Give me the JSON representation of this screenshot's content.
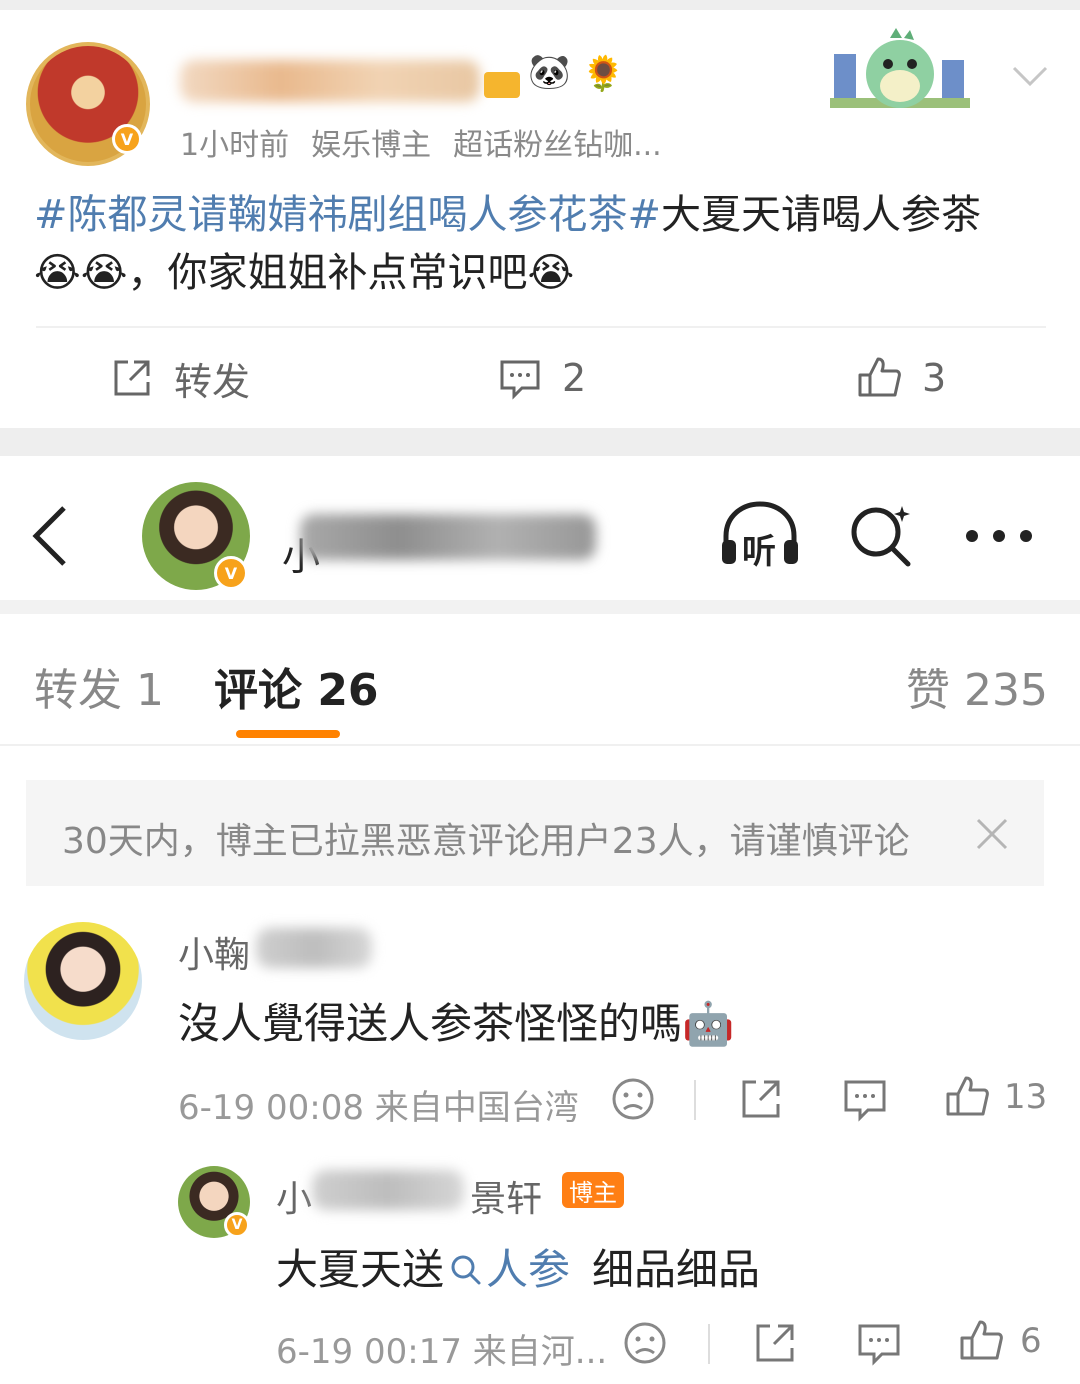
{
  "post": {
    "time": "1小时前",
    "role": "娱乐博主",
    "fan_status": "超话粉丝钻咖...",
    "hashtag": "#陈都灵请鞠婧祎剧组喝人参花茶#",
    "text_line1_rest": "大夏天请喝人参茶",
    "text_line2": "，你家姐姐补点常识吧",
    "emoji_cry": "😭",
    "repost_label": "转发",
    "comment_count": "2",
    "like_count": "3"
  },
  "header": {
    "back_icon": "back-arrow-icon",
    "listen_label": "听",
    "search_icon": "search-icon",
    "more_icon": "more-icon"
  },
  "tabs": {
    "repost": "转发 1",
    "comments": "评论 26",
    "likes": "赞 235"
  },
  "notice": {
    "text": "30天内，博主已拉黑恶意评论用户23人，请谨慎评论"
  },
  "comments": [
    {
      "name_visible": "小鞠",
      "text": "沒人覺得送人参茶怪怪的嗎",
      "emoji": "🤖",
      "date": "6-19 00:08",
      "source": "来自中国台湾",
      "likes": "13"
    },
    {
      "name_prefix": "小",
      "name_suffix": "景轩",
      "badge": "博主",
      "text_before": "大夏天送",
      "link": "人参",
      "text_after": "细品细品",
      "date": "6-19 00:17",
      "source": "来自河...",
      "likes": "6"
    }
  ],
  "colors": {
    "accent": "#ff8200",
    "link": "#507daf",
    "badge": "#ff7f14",
    "verified": "#f7a21b"
  }
}
